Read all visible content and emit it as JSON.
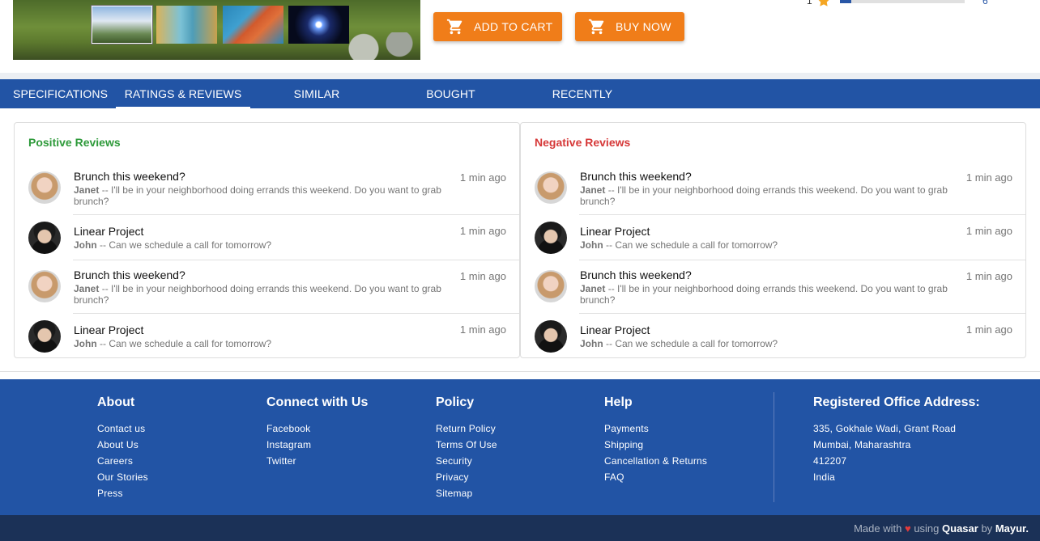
{
  "product": {
    "buttons": {
      "add_to_cart": "ADD TO CART",
      "buy_now": "BUY NOW"
    },
    "rating_row": {
      "stars": "1",
      "count": "6",
      "fill": 0.09
    }
  },
  "tabs": [
    {
      "label": "SPECIFICATIONS"
    },
    {
      "label": "RATINGS & REVIEWS",
      "active": true
    },
    {
      "label": "SIMILAR PRODUCTS"
    },
    {
      "label": "BOUGHT TOGETHER"
    },
    {
      "label": "RECENTLY VIEWED"
    }
  ],
  "reviews": {
    "positive": {
      "title": "Positive Reviews",
      "items": [
        {
          "title": "Brunch this weekend?",
          "author": "Janet",
          "text": " -- I'll be in your neighborhood doing errands this weekend. Do you want to grab brunch?",
          "time": "1 min ago"
        },
        {
          "title": "Linear Project",
          "author": "John",
          "text": " -- Can we schedule a call for tomorrow?",
          "time": "1 min ago"
        },
        {
          "title": "Brunch this weekend?",
          "author": "Janet",
          "text": " -- I'll be in your neighborhood doing errands this weekend. Do you want to grab brunch?",
          "time": "1 min ago"
        },
        {
          "title": "Linear Project",
          "author": "John",
          "text": " -- Can we schedule a call for tomorrow?",
          "time": "1 min ago"
        }
      ]
    },
    "negative": {
      "title": "Negative Reviews",
      "items": [
        {
          "title": "Brunch this weekend?",
          "author": "Janet",
          "text": " -- I'll be in your neighborhood doing errands this weekend. Do you want to grab brunch?",
          "time": "1 min ago"
        },
        {
          "title": "Linear Project",
          "author": "John",
          "text": " -- Can we schedule a call for tomorrow?",
          "time": "1 min ago"
        },
        {
          "title": "Brunch this weekend?",
          "author": "Janet",
          "text": " -- I'll be in your neighborhood doing errands this weekend. Do you want to grab brunch?",
          "time": "1 min ago"
        },
        {
          "title": "Linear Project",
          "author": "John",
          "text": " -- Can we schedule a call for tomorrow?",
          "time": "1 min ago"
        }
      ]
    }
  },
  "footer": {
    "about": {
      "heading": "About",
      "links": [
        "Contact us",
        "About Us",
        "Careers",
        "Our Stories",
        "Press"
      ]
    },
    "connect": {
      "heading": "Connect with Us",
      "links": [
        "Facebook",
        "Instagram",
        "Twitter"
      ]
    },
    "policy": {
      "heading": "Policy",
      "links": [
        "Return Policy",
        "Terms Of Use",
        "Security",
        "Privacy",
        "Sitemap"
      ]
    },
    "help": {
      "heading": "Help",
      "links": [
        "Payments",
        "Shipping",
        "Cancellation & Returns",
        "FAQ"
      ]
    },
    "office": {
      "heading": "Registered Office Address:",
      "lines": [
        "335, Gokhale Wadi, Grant Road",
        "Mumbai, Maharashtra",
        "412207",
        "India"
      ]
    }
  },
  "credits": {
    "made_with": "Made with",
    "heart": "♥",
    "using": "using",
    "framework": "Quasar",
    "by": "by",
    "author": "Mayur."
  },
  "colors": {
    "brand_blue": "#2254a5",
    "accent_orange": "#f07d19",
    "positive": "#2e9a3a",
    "negative": "#d63838"
  }
}
